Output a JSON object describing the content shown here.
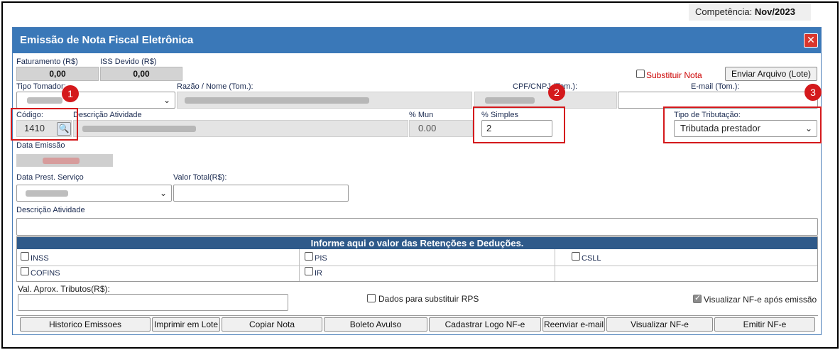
{
  "header": {
    "competencia_label": "Competência:",
    "competencia_value": "Nov/2023"
  },
  "dialog": {
    "title": "Emissão de Nota Fiscal Eletrônica",
    "close_glyph": "✕"
  },
  "summary": {
    "faturamento_label": "Faturamento (R$)",
    "faturamento_value": "0,00",
    "iss_label": "ISS Devido (R$)",
    "iss_value": "0,00"
  },
  "substituir": {
    "label": "Substituir Nota",
    "checked": false
  },
  "enviar_arquivo_button": "Enviar Arquivo (Lote)",
  "tomador": {
    "tipo_label": "Tipo Tomador:",
    "razao_label": "Razão / Nome (Tom.):",
    "cpf_label": "CPF/CNPJ (Tom.):",
    "email_label": "E-mail (Tom.):"
  },
  "servico": {
    "codigo_label": "Código:",
    "codigo_value": "1410",
    "descricao_label": "Descrição Atividade",
    "pct_mun_label": "% Mun",
    "pct_mun_value": "0.00",
    "pct_simples_label": "% Simples",
    "pct_simples_value": "2",
    "tipo_tributacao_label": "Tipo de Tributação:",
    "tipo_tributacao_value": "Tributada prestador"
  },
  "datas": {
    "data_emissao_label": "Data Emissão",
    "data_prest_label": "Data Prest. Serviço",
    "valor_total_label": "Valor Total(R$):",
    "valor_total_value": "",
    "descricao_atividade_label": "Descrição Atividade",
    "descricao_atividade_value": ""
  },
  "retencoes": {
    "header": "Informe aqui o valor das Retenções e Deduções.",
    "items": [
      {
        "label": "INSS",
        "checked": false
      },
      {
        "label": "PIS",
        "checked": false
      },
      {
        "label": "CSLL",
        "checked": false
      },
      {
        "label": "COFINS",
        "checked": false
      },
      {
        "label": "IR",
        "checked": false
      }
    ]
  },
  "bottom": {
    "val_aprox_label": "Val. Aprox. Tributos(R$):",
    "val_aprox_value": "",
    "dados_rps_label": "Dados para substituir RPS",
    "dados_rps_checked": false,
    "visualizar_apos_label": "Visualizar NF-e após emissão",
    "visualizar_apos_checked": true
  },
  "actions": [
    "Historico Emissoes",
    "Imprimir em Lote",
    "Copiar Nota",
    "Boleto Avulso",
    "Cadastrar Logo NF-e",
    "Reenviar e-mail",
    "Visualizar NF-e",
    "Emitir NF-e"
  ],
  "annotations": [
    "1",
    "2",
    "3"
  ],
  "colors": {
    "title_bar": "#3a78b8",
    "retencoes_header": "#2f5a8a",
    "annotation_red": "#d4191c",
    "substituir_text": "#cc0000"
  }
}
